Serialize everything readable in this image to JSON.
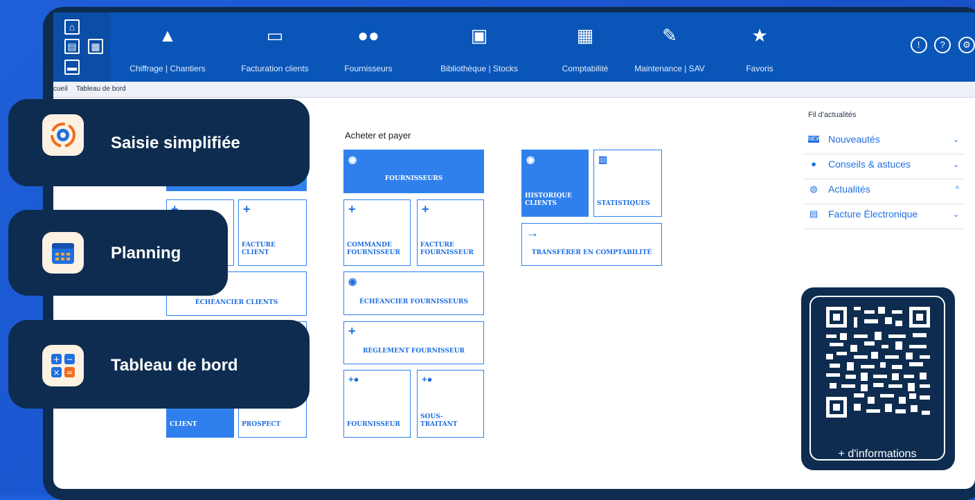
{
  "navbar": {
    "items": [
      {
        "label": "Chiffrage | Chantiers",
        "icon": "cone-icon"
      },
      {
        "label": "Facturation clients",
        "icon": "card-icon"
      },
      {
        "label": "Fournisseurs",
        "icon": "users-icon"
      },
      {
        "label": "Bibliothèque | Stocks",
        "icon": "box-icon"
      },
      {
        "label": "Comptabilité",
        "icon": "calculator-icon"
      },
      {
        "label": "Maintenance | SAV",
        "icon": "wrench-icon"
      },
      {
        "label": "Favoris",
        "icon": "star-icon"
      }
    ]
  },
  "breadcrumb": {
    "home": "cueil",
    "current": "Tableau de bord"
  },
  "buy_section": {
    "title": "Acheter et payer"
  },
  "tiles": {
    "fournisseurs": "FOURNISSEURS",
    "historique_clients": "HISTORIQUE CLIENTS",
    "statistiques": "STATISTIQUES",
    "facture_client": "FACTURE CLIENT",
    "commande_fournisseur": "COMMANDE FOURNISSEUR",
    "facture_fournisseur": "FACTURE FOURNISSEUR",
    "transferer": "TRANSFÉRER EN COMPTABILITÉ",
    "echeancier_clients": "ÉCHÉANCIER CLIENTS",
    "echeancier_fournisseurs": "ÉCHÉANCIER FOURNISSEURS",
    "reglement_fournisseur": "RÈGLEMENT FOURNISSEUR",
    "client": "CLIENT",
    "prospect": "PROSPECT",
    "new_fournisseur": "FOURNISSEUR",
    "sous_traitant": "SOUS-TRAITANT"
  },
  "news": {
    "title": "Fil d'actualités",
    "items": [
      {
        "label": "Nouveautés",
        "icon": "new-badge-icon",
        "chevron": "⌄"
      },
      {
        "label": "Conseils & astuces",
        "icon": "lightbulb-icon",
        "chevron": "⌄"
      },
      {
        "label": "Actualités",
        "icon": "globe-icon",
        "chevron": "^"
      },
      {
        "label": "Facture Électronique",
        "icon": "document-icon",
        "chevron": "⌄"
      }
    ]
  },
  "features": [
    {
      "label": "Saisie simplifiée",
      "icon": "gear-sync-icon",
      "accent": "#f26b21"
    },
    {
      "label": "Planning",
      "icon": "calendar-icon",
      "accent": "#1f6fe0"
    },
    {
      "label": "Tableau de bord",
      "icon": "calculator-icon",
      "accent": "#1f6fe0"
    }
  ],
  "qr": {
    "label": "+ d'informations"
  }
}
